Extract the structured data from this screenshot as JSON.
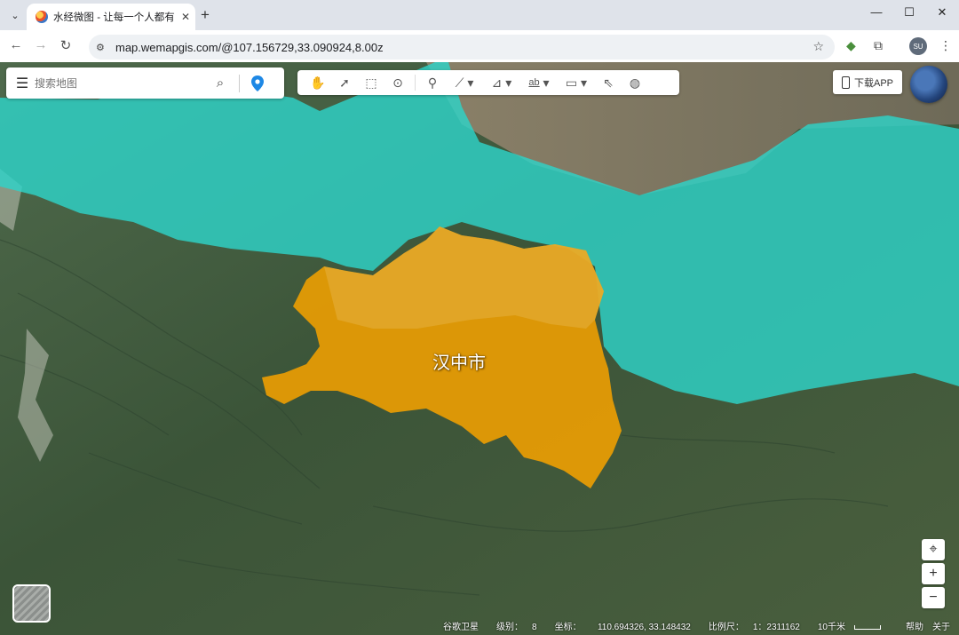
{
  "browser": {
    "tab_title": "水经微图 - 让每一个人都有自己",
    "url": "map.wemapgis.com/@107.156729,33.090924,8.00z",
    "profile_initials": "SU"
  },
  "search": {
    "placeholder": "搜索地图"
  },
  "toolbar": {
    "text_tool_label": "ab"
  },
  "app_download_label": "下载APP",
  "region": {
    "name": "汉中市",
    "fill_color": "#f2a100",
    "neighbor_color": "#2ed3c8"
  },
  "status": {
    "basemap": "谷歌卫星",
    "level_label": "级别：",
    "level": "8",
    "coord_label": "坐标：",
    "coords": "110.694326, 33.148432",
    "scale_label": "比例尺：",
    "scale": "1：2311162",
    "scale_bar": "10千米",
    "help": "帮助",
    "about": "关于"
  }
}
